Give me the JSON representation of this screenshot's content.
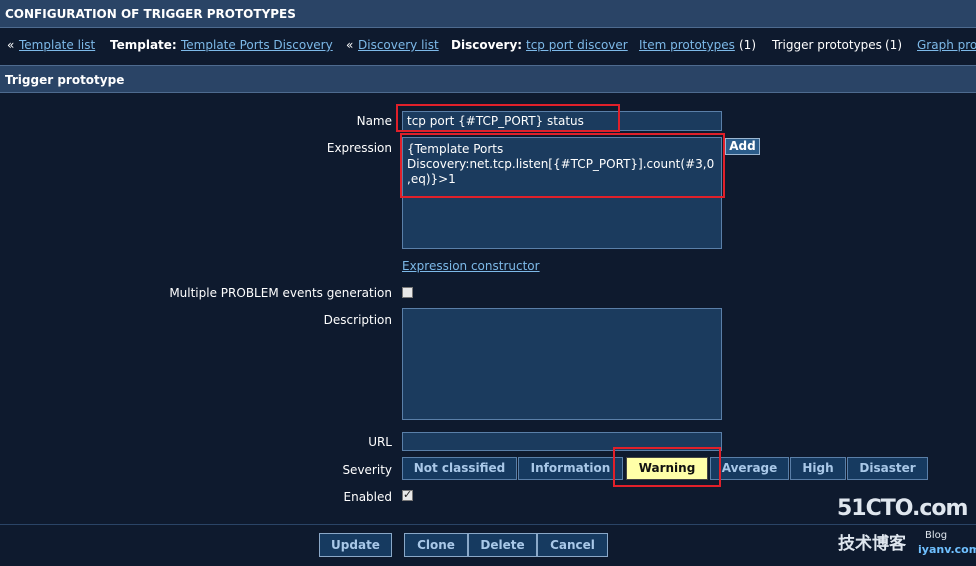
{
  "header": {
    "title": "CONFIGURATION OF TRIGGER PROTOTYPES"
  },
  "breadcrumbs": {
    "sep": "«",
    "template_list": "Template list",
    "template_label": "Template:",
    "template_name": "Template Ports Discovery",
    "discovery_list": "Discovery list",
    "discovery_label": "Discovery:",
    "discovery_name": "tcp port discover",
    "item_prototypes": "Item prototypes",
    "item_prototypes_count": "(1)",
    "trigger_prototypes": "Trigger prototypes",
    "trigger_prototypes_count": "(1)",
    "graph_prototypes": "Graph pro"
  },
  "form": {
    "section_title": "Trigger prototype",
    "name_label": "Name",
    "name_value": "tcp port {#TCP_PORT} status",
    "expression_label": "Expression",
    "expression_value": "{Template Ports Discovery:net.tcp.listen[{#TCP_PORT}].count(#3,0,eq)}>1",
    "add_label": "Add",
    "expression_constructor": "Expression constructor",
    "multiple_events_label": "Multiple PROBLEM events generation",
    "multiple_events_checked": false,
    "description_label": "Description",
    "description_value": "",
    "url_label": "URL",
    "url_value": "",
    "severity_label": "Severity",
    "severity_options": [
      "Not classified",
      "Information",
      "Warning",
      "Average",
      "High",
      "Disaster"
    ],
    "severity_selected": "Warning",
    "enabled_label": "Enabled",
    "enabled_checked": true
  },
  "buttons": {
    "update": "Update",
    "clone": "Clone",
    "delete": "Delete",
    "cancel": "Cancel"
  },
  "watermark": {
    "line1": "51CTO.com",
    "line2": "技术博客",
    "line3": "iyanv.com",
    "line4": "Blog"
  },
  "colors": {
    "background": "#0e1a2e",
    "header_bar": "#2a4466",
    "link": "#7db9e8",
    "selected_severity": "#ffffa8",
    "highlight_box": "#e0202a"
  }
}
